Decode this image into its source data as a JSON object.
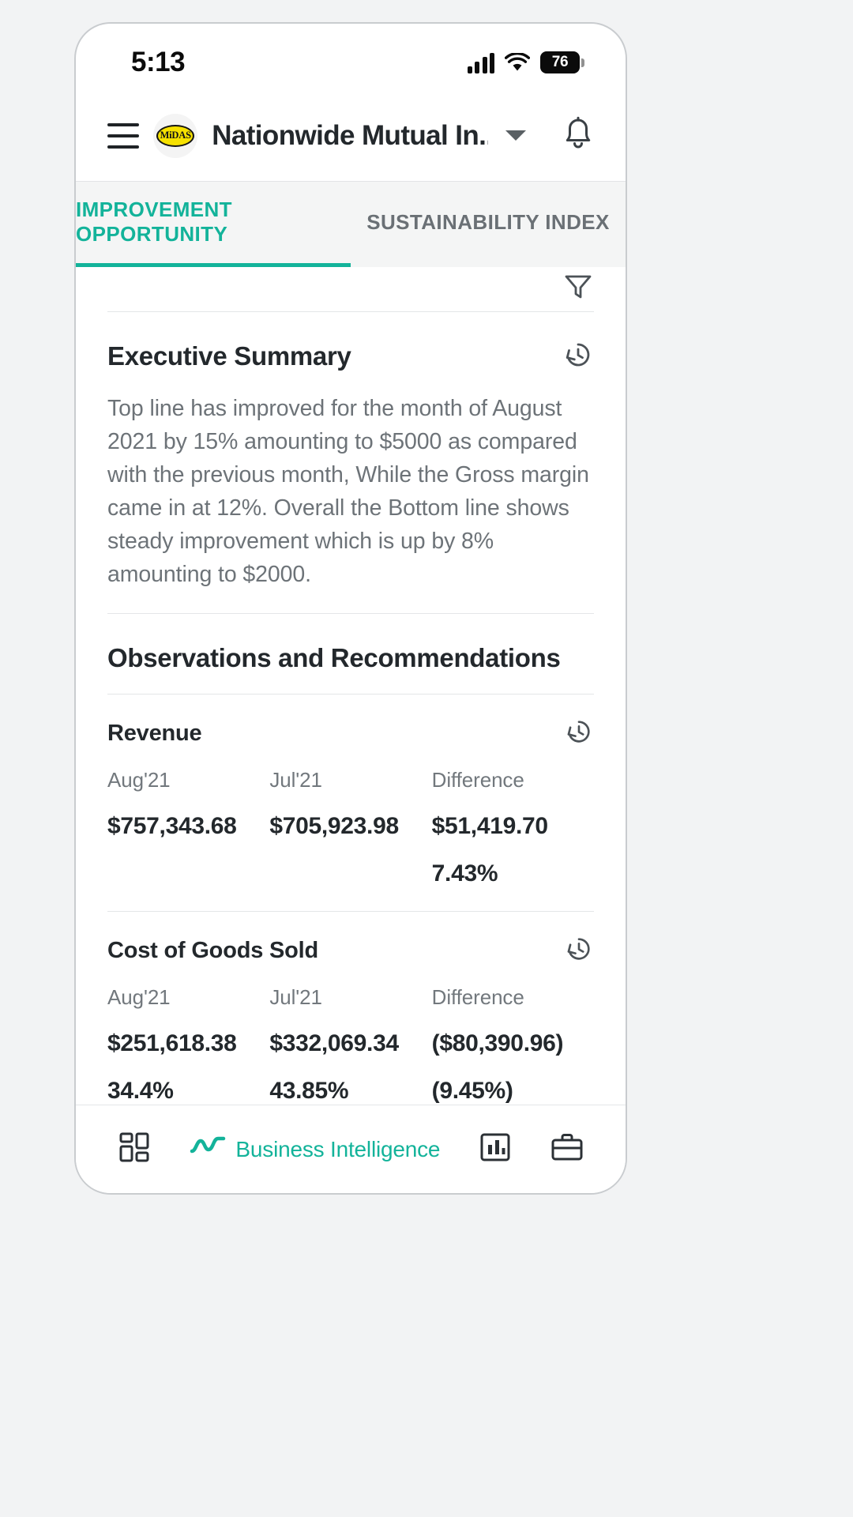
{
  "status_bar": {
    "time": "5:13",
    "signal_icon": "cellular-signal-icon",
    "wifi_icon": "wifi-icon",
    "battery_level": "76",
    "battery_icon": "battery-icon"
  },
  "app_bar": {
    "menu_icon": "hamburger-menu-icon",
    "logo_text": "MiDAS",
    "logo_icon": "midas-logo-icon",
    "title": "Nationwide Mutual In...",
    "dropdown_icon": "chevron-down-icon",
    "notification_icon": "bell-icon"
  },
  "tabs": [
    {
      "label": "IMPROVEMENT OPPORTUNITY",
      "active": true
    },
    {
      "label": "SUSTAINABILITY INDEX",
      "active": false
    }
  ],
  "toolbar": {
    "filter_icon": "filter-icon"
  },
  "executive_summary": {
    "title": "Executive Summary",
    "history_icon": "history-icon",
    "body": "Top line has improved for the month of August 2021 by 15% amounting to $5000 as compared with the previous month, While the Gross margin came in at 12%. Overall the Bottom line shows steady improvement which is up by 8% amounting to $2000."
  },
  "observations": {
    "title": "Observations and Recommendations",
    "metrics": [
      {
        "name": "Revenue",
        "history_icon": "history-icon",
        "columns": [
          "Aug'21",
          "Jul'21",
          "Difference"
        ],
        "amounts": [
          "$757,343.68",
          "$705,923.98",
          "$51,419.70"
        ],
        "percents": [
          "",
          "",
          "7.43%"
        ]
      },
      {
        "name": "Cost of Goods Sold",
        "history_icon": "history-icon",
        "columns": [
          "Aug'21",
          "Jul'21",
          "Difference"
        ],
        "amounts": [
          "$251,618.38",
          "$332,069.34",
          "($80,390.96)"
        ],
        "percents": [
          "34.4%",
          "43.85%",
          "(9.45%)"
        ]
      }
    ]
  },
  "bottom_nav": [
    {
      "icon": "dashboard-grid-icon",
      "label": "",
      "active": false
    },
    {
      "icon": "trending-chart-icon",
      "label": "Business Intelligence",
      "active": true
    },
    {
      "icon": "bar-chart-icon",
      "label": "",
      "active": false
    },
    {
      "icon": "briefcase-icon",
      "label": "",
      "active": false
    }
  ],
  "colors": {
    "accent": "#13b39a",
    "text_primary": "#23282c",
    "text_secondary": "#6d7378",
    "divider": "#e4e6e8",
    "page_background": "#f2f3f4",
    "logo_yellow": "#f6e100"
  }
}
